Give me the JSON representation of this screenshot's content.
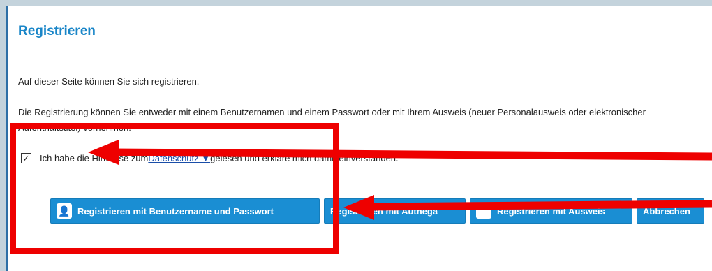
{
  "page": {
    "title": "Registrieren",
    "intro": "Auf dieser Seite können Sie sich registrieren.",
    "description": "Die Registrierung können Sie entweder mit einem Benutzernamen und einem Passwort oder mit Ihrem Ausweis (neuer Personalausweis oder elektronischer Aufenthaltstitel) vornehmen."
  },
  "consent": {
    "checkbox_mark": "☑",
    "text_before": "Ich habe die Hinweise zum ",
    "link": "Datenschutz ▼",
    "text_after": " gelesen und erkläre mich damit einverstanden."
  },
  "buttons": {
    "register_username": "Registrieren mit Benutzername und Passwort",
    "register_authega": "Registrieren mit Authega",
    "register_ausweis": "Registrieren mit Ausweis",
    "cancel": "Abbrechen"
  },
  "icons": {
    "user": "user-icon",
    "ausweis": "id-card-icon"
  },
  "colors": {
    "accent": "#1a8ed3",
    "title": "#1a86c8",
    "annotation_red": "#ee0000"
  }
}
